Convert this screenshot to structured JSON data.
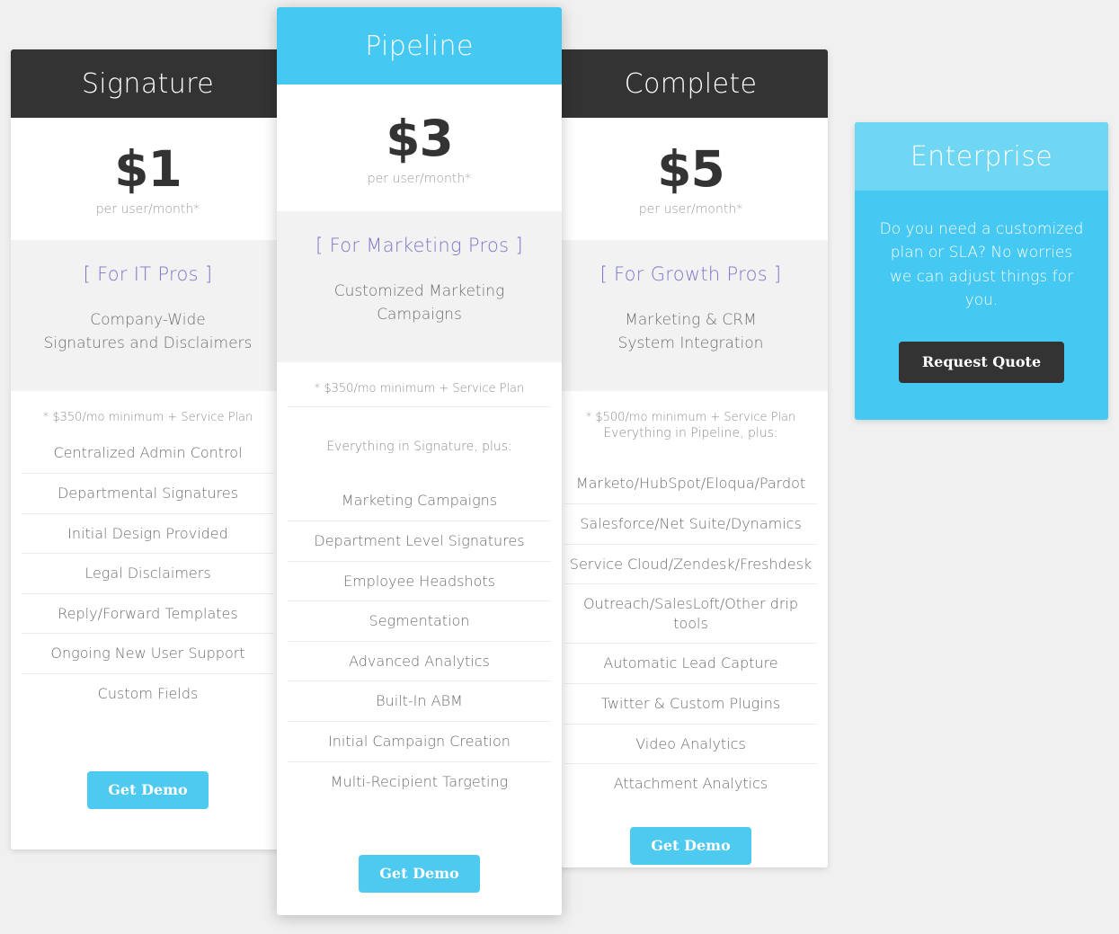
{
  "page": {
    "background_color": "#f0f0f0",
    "accent_color": "#45c8f1",
    "dark_color": "#333333",
    "audience_color": "#7d78c8"
  },
  "plans": [
    {
      "name": "Signature",
      "price": "$1",
      "price_unit": "per user/month*",
      "audience": "[ For IT Pros ]",
      "summary": "Company-Wide\nSignatures and Disclaimers",
      "footnote": "* $350/mo minimum + Service Plan",
      "inherits": "",
      "features": [
        "Centralized Admin Control",
        "Departmental Signatures",
        "Initial Design Provided",
        "Legal Disclaimers",
        "Reply/Forward Templates",
        "Ongoing New User Support",
        "Custom Fields"
      ],
      "cta_label": "Get Demo"
    },
    {
      "name": "Pipeline",
      "price": "$3",
      "price_unit": "per user/month*",
      "audience": "[ For Marketing Pros ]",
      "summary": "Customized Marketing\nCampaigns",
      "footnote": "* $350/mo minimum + Service Plan",
      "inherits": "Everything in Signature, plus:",
      "features": [
        "Marketing Campaigns",
        "Department Level Signatures",
        "Employee Headshots",
        "Segmentation",
        "Advanced Analytics",
        "Built-In ABM",
        "Initial Campaign Creation",
        "Multi-Recipient Targeting"
      ],
      "cta_label": "Get Demo"
    },
    {
      "name": "Complete",
      "price": "$5",
      "price_unit": "per user/month*",
      "audience": "[ For Growth Pros ]",
      "summary": "Marketing & CRM\nSystem Integration",
      "footnote": "* $500/mo minimum + Service Plan",
      "inherits": "Everything in Pipeline, plus:",
      "features": [
        "Marketo/HubSpot/Eloqua/Pardot",
        "Salesforce/Net Suite/Dynamics",
        "Service Cloud/Zendesk/Freshdesk",
        "Outreach/SalesLoft/Other drip tools",
        "Automatic Lead Capture",
        "Twitter & Custom Plugins",
        "Video Analytics",
        "Attachment Analytics"
      ],
      "cta_label": "Get Demo"
    }
  ],
  "enterprise": {
    "name": "Enterprise",
    "description": "Do you need a customized plan or SLA? No worries we can adjust things for you.",
    "cta_label": "Request Quote"
  }
}
